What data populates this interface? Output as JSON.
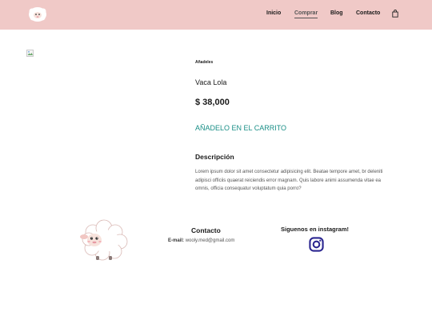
{
  "nav": {
    "items": [
      {
        "label": "Inicio"
      },
      {
        "label": "Comprar"
      },
      {
        "label": "Blog"
      },
      {
        "label": "Contacto"
      }
    ],
    "active": "Comprar"
  },
  "product": {
    "category": "Añadeles",
    "name": "Vaca Lola",
    "price": "$ 38,000",
    "add_to_cart": "AÑADELO EN EL CARRITO",
    "description_title": "Descripción",
    "description": "Lorem ipsum dolor sit amet consectetur adipisicing elit. Beatae tempore amet, br deleniti adipisci officiis quaerat reiciendis error magnam. Quis labore animi assumenda vitae ea omnis, officia consequatur voluptatum quia porro?"
  },
  "footer": {
    "contact_title": "Contacto",
    "email_label": "E-mail:",
    "email_value": "wooly.med@gmail.com",
    "instagram_title": "Siguenos en instagram!"
  },
  "colors": {
    "header_bg": "#f0c9c7",
    "accent": "#1a8f87",
    "instagram": "#2b2690"
  },
  "icons": [
    "sheep-logo-icon",
    "shopping-bag-icon",
    "broken-image-icon",
    "sheep-mascot-icon",
    "instagram-icon"
  ]
}
